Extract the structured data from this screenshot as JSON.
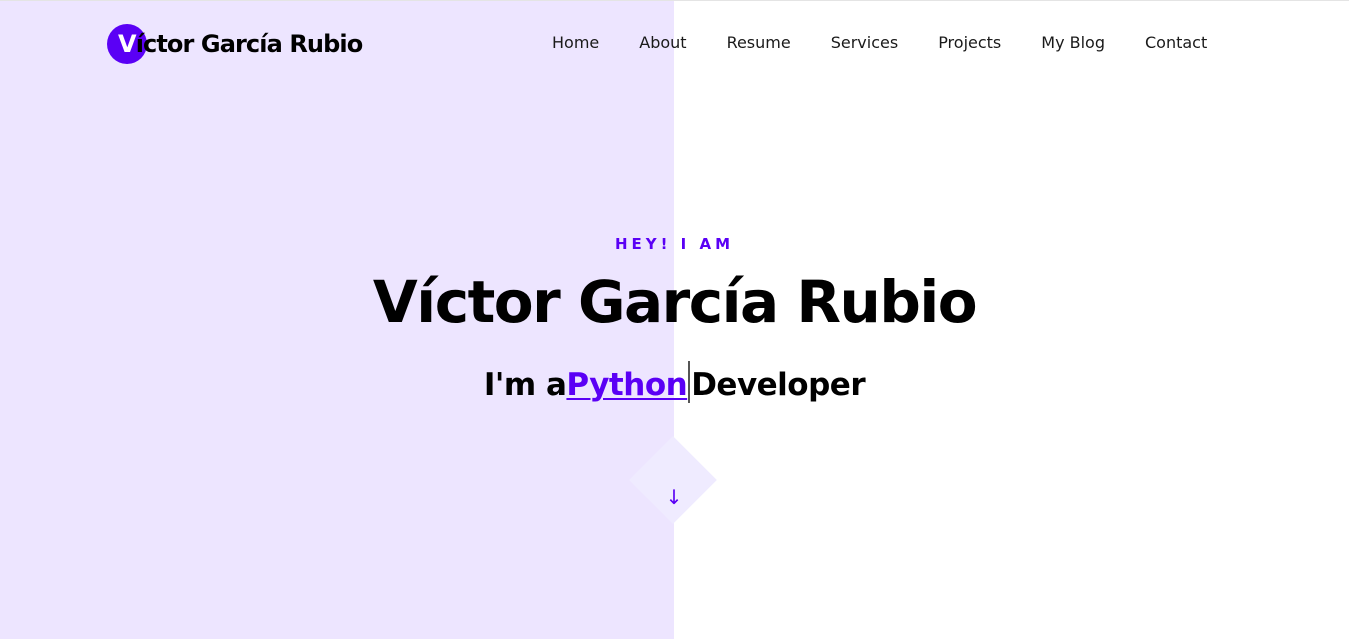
{
  "header": {
    "logo_initial": "V",
    "logo_rest": "íctor García Rubio",
    "nav": [
      {
        "label": "Home"
      },
      {
        "label": "About"
      },
      {
        "label": "Resume"
      },
      {
        "label": "Services"
      },
      {
        "label": "Projects"
      },
      {
        "label": "My Blog"
      },
      {
        "label": "Contact"
      }
    ]
  },
  "hero": {
    "eyebrow": "HEY! I AM",
    "name": "Víctor García Rubio",
    "role_prefix": "I'm a",
    "role_typed": "Python",
    "role_suffix": "Developer",
    "scroll_icon": "arrow-down-icon",
    "scroll_glyph": "↓"
  },
  "colors": {
    "accent": "#5a00f5",
    "left_panel": "#ede5ff",
    "diamond": "#efebff",
    "text": "#000000"
  }
}
